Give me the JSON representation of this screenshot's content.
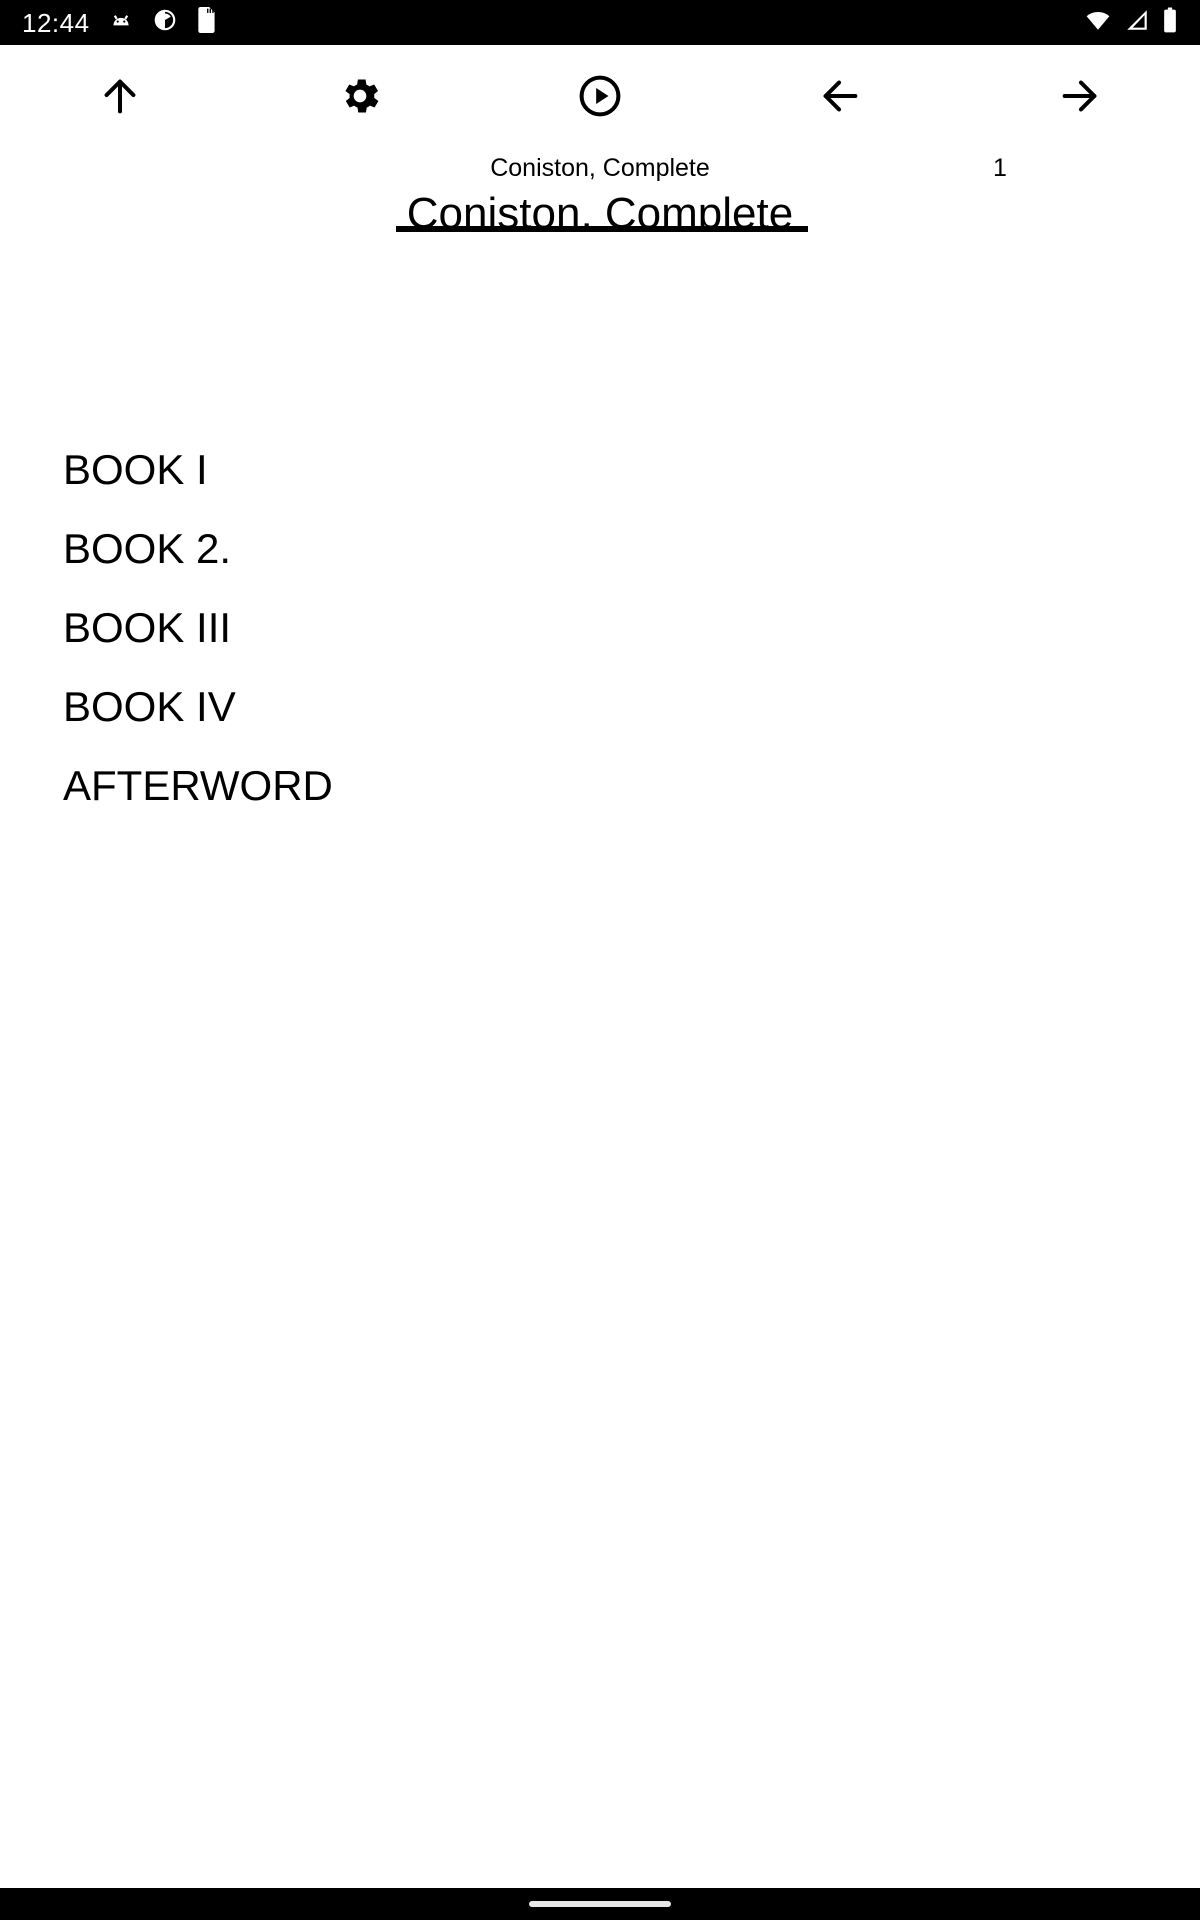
{
  "status_bar": {
    "clock": "12:44",
    "left_icons": [
      {
        "name": "android-head-icon",
        "glyph": "android"
      },
      {
        "name": "clock-circle-icon",
        "glyph": "clock"
      },
      {
        "name": "sd-card-icon",
        "glyph": "sdcard"
      }
    ],
    "right_icons": [
      {
        "name": "wifi-icon",
        "glyph": "wifi"
      },
      {
        "name": "cellular-signal-icon",
        "glyph": "signal"
      },
      {
        "name": "battery-icon",
        "glyph": "battery"
      }
    ],
    "background_color": "#000000",
    "foreground_color": "#ffffff"
  },
  "toolbar": {
    "buttons": [
      {
        "name": "scroll-up-button",
        "icon": "arrow-up-icon",
        "label": "Up"
      },
      {
        "name": "settings-button",
        "icon": "gear-icon",
        "label": "Settings"
      },
      {
        "name": "play-button",
        "icon": "play-circle-icon",
        "label": "Play"
      },
      {
        "name": "previous-button",
        "icon": "arrow-left-icon",
        "label": "Back"
      },
      {
        "name": "next-button",
        "icon": "arrow-right-icon",
        "label": "Forward"
      }
    ]
  },
  "title_block": {
    "subtitle": "Coniston, Complete",
    "heading": "Coniston, Complete",
    "page_number": "1"
  },
  "contents": {
    "items": [
      {
        "label": "BOOK I"
      },
      {
        "label": "BOOK 2."
      },
      {
        "label": "BOOK III"
      },
      {
        "label": "BOOK IV"
      },
      {
        "label": "AFTERWORD"
      }
    ]
  },
  "nav_bar": {
    "gesture_pill": "home-gesture-pill",
    "background_color": "#000000",
    "pill_color": "#e8e8e8"
  },
  "theme": {
    "page_background": "#ffffff",
    "text_color": "#000000"
  }
}
